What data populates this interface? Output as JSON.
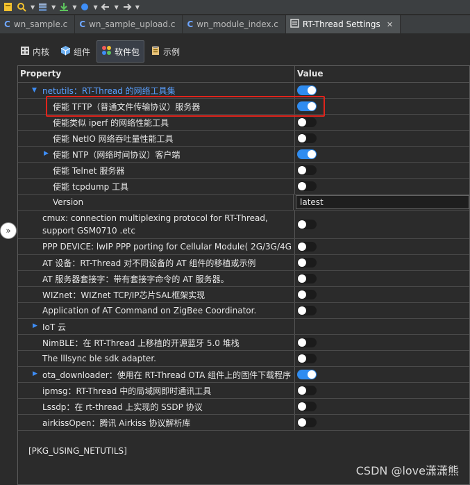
{
  "tabs": [
    {
      "label": "wn_sample.c",
      "active": false
    },
    {
      "label": "wn_sample_upload.c",
      "active": false
    },
    {
      "label": "wn_module_index.c",
      "active": false
    },
    {
      "label": "RT-Thread Settings",
      "active": true
    }
  ],
  "subtabs": [
    {
      "label": "内核",
      "icon": "kernel-icon"
    },
    {
      "label": "组件",
      "icon": "cube-icon"
    },
    {
      "label": "软件包",
      "icon": "package-icon",
      "active": true
    },
    {
      "label": "示例",
      "icon": "clipboard-icon"
    }
  ],
  "grid": {
    "header_property": "Property",
    "header_value": "Value",
    "rows": [
      {
        "label": "netutils：RT-Thread 的网络工具集",
        "level": 0,
        "arrow": "down",
        "value": "on",
        "selected": true
      },
      {
        "label": "使能 TFTP（普通文件传输协议）服务器",
        "level": 1,
        "value": "on"
      },
      {
        "label": "使能类似 iperf 的网络性能工具",
        "level": 1,
        "value": "off"
      },
      {
        "label": "使能 NetIO 网络吞吐量性能工具",
        "level": 1,
        "value": "off"
      },
      {
        "label": "使能 NTP（网络时间协议）客户端",
        "level": 1,
        "arrow": "right",
        "value": "on"
      },
      {
        "label": "使能 Telnet 服务器",
        "level": 1,
        "value": "off"
      },
      {
        "label": "使能 tcpdump 工具",
        "level": 1,
        "value": "off"
      },
      {
        "label": "Version",
        "level": 1,
        "value": "select",
        "select_value": "latest"
      },
      {
        "label": "cmux: connection multiplexing protocol for RT-Thread, support GSM0710 .etc",
        "level": 0,
        "value": "off",
        "tall": true
      },
      {
        "label": "PPP DEVICE: lwIP PPP porting for Cellular Module( 2G/3G/4G )",
        "level": 0,
        "value": "off"
      },
      {
        "label": "AT 设备：RT-Thread 对不同设备的 AT 组件的移植或示例",
        "level": 0,
        "value": "off"
      },
      {
        "label": "AT 服务器套接字：带有套接字命令的 AT 服务器。",
        "level": 0,
        "value": "off"
      },
      {
        "label": "WIZnet：WIZnet TCP/IP芯片SAL框架实现",
        "level": 0,
        "value": "off"
      },
      {
        "label": "Application of AT Command on ZigBee Coordinator.",
        "level": 0,
        "value": "off"
      },
      {
        "label": "IoT 云",
        "level": 0,
        "arrow": "right",
        "value": "none"
      },
      {
        "label": "NimBLE：在 RT-Thread 上移植的开源蓝牙 5.0 堆栈",
        "level": 0,
        "value": "off"
      },
      {
        "label": "The lllsync ble sdk adapter.",
        "level": 0,
        "value": "off"
      },
      {
        "label": "ota_downloader：使用在 RT-Thread OTA 组件上的固件下载程序",
        "level": 0,
        "arrow": "right",
        "value": "on"
      },
      {
        "label": "ipmsg：RT-Thread 中的局域网即时通讯工具",
        "level": 0,
        "value": "off"
      },
      {
        "label": "Lssdp：在 rt-thread 上实现的 SSDP 协议",
        "level": 0,
        "value": "off"
      },
      {
        "label": "airkissOpen：腾讯 Airkiss 协议解析库",
        "level": 0,
        "value": "off"
      }
    ]
  },
  "macro_name": "[PKG_USING_NETUTILS]",
  "side_button": "»",
  "watermark": "CSDN @love潇潇熊",
  "colors": {
    "accent": "#2f8cf0",
    "highlight_box": "#e0241c",
    "selected_text": "#5aa0ff"
  }
}
